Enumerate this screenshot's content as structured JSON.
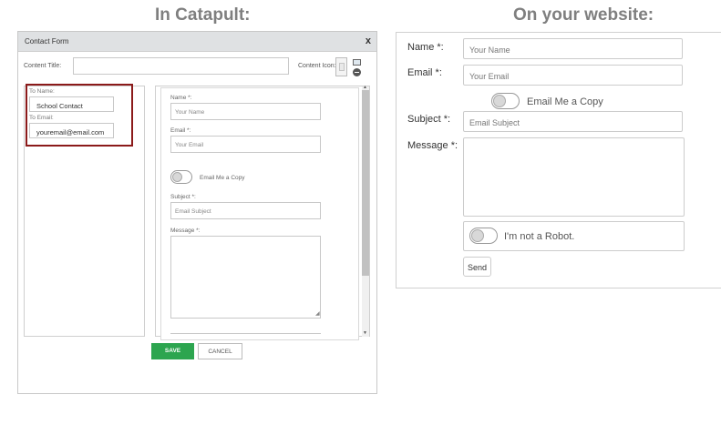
{
  "headings": {
    "left": "In Catapult:",
    "right": "On your website:"
  },
  "catapult": {
    "window_title": "Contact Form",
    "close_glyph": "x",
    "content_title_label": "Content Title:",
    "content_icon_label": "Content Icon:",
    "to_name_label": "To Name:",
    "to_name_value": "School Contact",
    "to_email_label": "To Email:",
    "to_email_value": "youremail@email.com",
    "form": {
      "name_label": "Name *:",
      "name_placeholder": "Your Name",
      "email_label": "Email *:",
      "email_placeholder": "Your Email",
      "copy_label": "Email Me a Copy",
      "subject_label": "Subject *:",
      "subject_placeholder": "Email Subject",
      "message_label": "Message *:"
    },
    "save_label": "SAVE",
    "cancel_label": "CANCEL"
  },
  "website": {
    "name_label": "Name *:",
    "name_placeholder": "Your Name",
    "email_label": "Email *:",
    "email_placeholder": "Your Email",
    "copy_label": "Email Me a Copy",
    "subject_label": "Subject *:",
    "subject_placeholder": "Email Subject",
    "message_label": "Message *:",
    "robot_label": "I'm not a Robot.",
    "send_label": "Send"
  }
}
